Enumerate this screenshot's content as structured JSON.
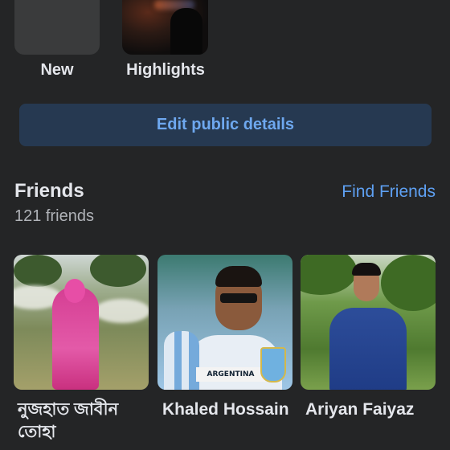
{
  "highlights": {
    "new_label": "New",
    "highlights_label": "Highlights"
  },
  "edit_button": {
    "label": "Edit public details"
  },
  "friends": {
    "title": "Friends",
    "count": "121 friends",
    "find_link": "Find Friends",
    "items": [
      {
        "name": "নুজহাত জাবীন তোহা"
      },
      {
        "name": "Khaled Hossain",
        "photo_banner": "ARGENTINA"
      },
      {
        "name": "Ariyan Faiyaz"
      }
    ]
  },
  "colors": {
    "background": "#242526",
    "button_bg": "#263951",
    "link": "#5ea0f2"
  }
}
